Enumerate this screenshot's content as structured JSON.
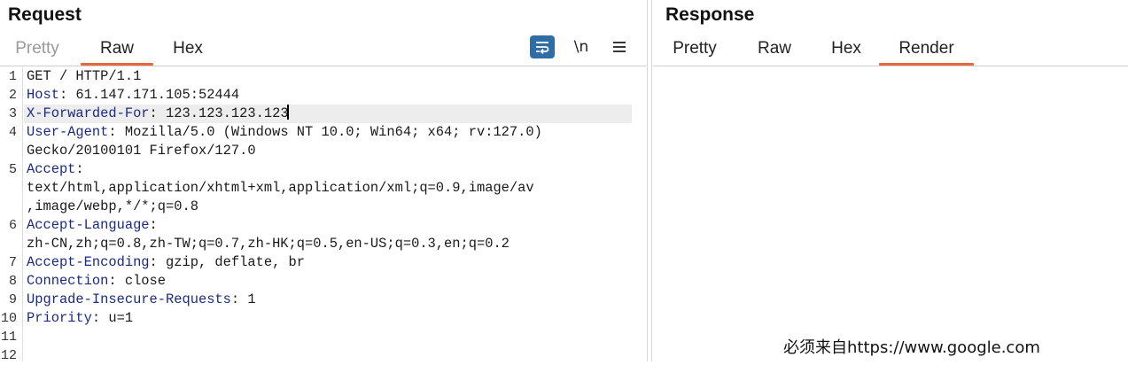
{
  "request": {
    "title": "Request",
    "tabs": [
      {
        "label": "Pretty",
        "state": "dim"
      },
      {
        "label": "Raw",
        "state": "active"
      },
      {
        "label": "Hex",
        "state": "normal"
      }
    ],
    "tools": {
      "wrap_icon": "text-wrap-icon",
      "newline_label": "\\n",
      "menu_icon": "hamburger-menu-icon"
    },
    "lines": [
      {
        "n": "1",
        "parts": [
          {
            "t": "GET / HTTP/1.1",
            "k": false
          }
        ]
      },
      {
        "n": "2",
        "parts": [
          {
            "t": "Host",
            "k": true
          },
          {
            "t": ": 61.147.171.105:52444",
            "k": false
          }
        ]
      },
      {
        "n": "3",
        "parts": [
          {
            "t": "X-Forwarded-For",
            "k": true
          },
          {
            "t": ": 123.123.123.123",
            "k": false
          }
        ],
        "highlight": true
      },
      {
        "n": "4",
        "parts": [
          {
            "t": "User-Agent",
            "k": true
          },
          {
            "t": ": Mozilla/5.0 (Windows NT 10.0; Win64; x64; rv:127.0)",
            "k": false
          }
        ]
      },
      {
        "n": "",
        "parts": [
          {
            "t": "Gecko/20100101 Firefox/127.0",
            "k": false
          }
        ]
      },
      {
        "n": "5",
        "parts": [
          {
            "t": "Accept",
            "k": true
          },
          {
            "t": ":",
            "k": false
          }
        ]
      },
      {
        "n": "",
        "parts": [
          {
            "t": "text/html,application/xhtml+xml,application/xml;q=0.9,image/av",
            "k": false
          }
        ]
      },
      {
        "n": "",
        "parts": [
          {
            "t": ",image/webp,*/*;q=0.8",
            "k": false
          }
        ]
      },
      {
        "n": "6",
        "parts": [
          {
            "t": "Accept-Language",
            "k": true
          },
          {
            "t": ":",
            "k": false
          }
        ]
      },
      {
        "n": "",
        "parts": [
          {
            "t": "zh-CN,zh;q=0.8,zh-TW;q=0.7,zh-HK;q=0.5,en-US;q=0.3,en;q=0.2",
            "k": false
          }
        ]
      },
      {
        "n": "7",
        "parts": [
          {
            "t": "Accept-Encoding",
            "k": true
          },
          {
            "t": ": gzip, deflate, br",
            "k": false
          }
        ]
      },
      {
        "n": "8",
        "parts": [
          {
            "t": "Connection",
            "k": true
          },
          {
            "t": ": close",
            "k": false
          }
        ]
      },
      {
        "n": "9",
        "parts": [
          {
            "t": "Upgrade-Insecure-Requests",
            "k": true
          },
          {
            "t": ": 1",
            "k": false
          }
        ]
      },
      {
        "n": "10",
        "parts": [
          {
            "t": "Priority",
            "k": true
          },
          {
            "t": ": u=1",
            "k": false
          }
        ]
      },
      {
        "n": "11",
        "parts": []
      },
      {
        "n": "12",
        "parts": []
      }
    ]
  },
  "response": {
    "title": "Response",
    "tabs": [
      {
        "label": "Pretty",
        "state": "normal"
      },
      {
        "label": "Raw",
        "state": "normal"
      },
      {
        "label": "Hex",
        "state": "normal"
      },
      {
        "label": "Render",
        "state": "active"
      }
    ],
    "render_text": "必须来自https://www.google.com"
  },
  "colors": {
    "accent_underline": "#e8683e",
    "header_key": "#1b2a82",
    "wrap_button_bg": "#2f6da5"
  }
}
